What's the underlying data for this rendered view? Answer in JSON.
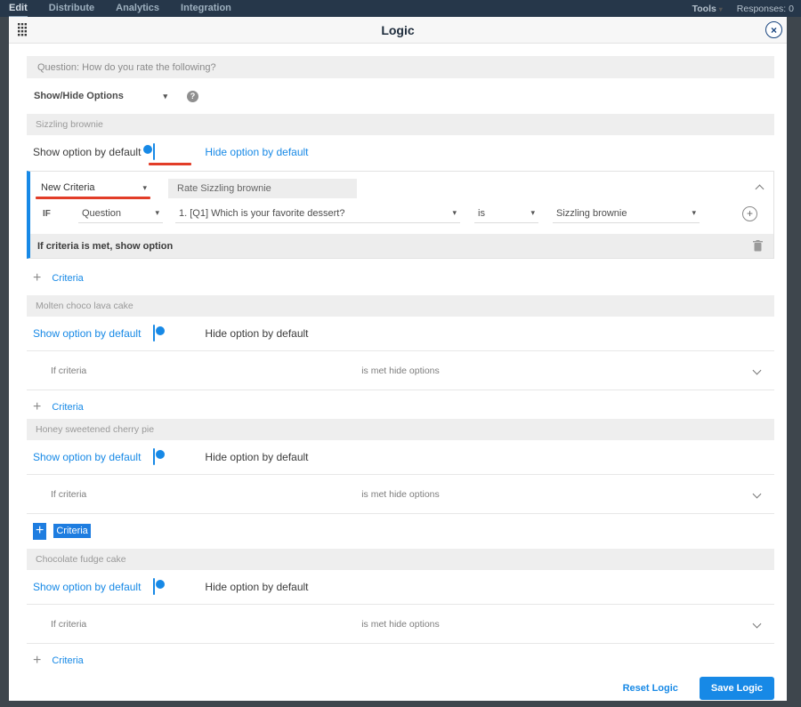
{
  "colors": {
    "accent": "#1789e6",
    "annotation_red": "#e23d28",
    "topnav_bg": "#26374a",
    "selection_blue": "#1e7de0"
  },
  "icons": {
    "caret": "▾",
    "help": "?",
    "close": "×",
    "plus": "+"
  },
  "topnav": {
    "items": [
      "Edit",
      "Distribute",
      "Analytics",
      "Integration"
    ],
    "tools": "Tools",
    "responses": "Responses: 0"
  },
  "modal": {
    "title": "Logic"
  },
  "question_bar": "Question: How do you rate the following?",
  "logic_type": {
    "value": "Show/Hide Options"
  },
  "toggle_labels": {
    "show": "Show option by default",
    "hide": "Hide option by default"
  },
  "add_criteria_label": "Criteria",
  "sections": [
    {
      "title": "Sizzling brownie",
      "card": {
        "criteria_name": "New Criteria",
        "option_ref": "Rate Sizzling brownie",
        "if": "IF",
        "subject": "Question",
        "question": "1. [Q1] Which is your favorite dessert?",
        "operator": "is",
        "value": "Sizzling brownie",
        "result": "If criteria is met, show option"
      }
    },
    {
      "title": "Molten choco lava cake",
      "collapsed_left": "If criteria",
      "collapsed_right": "is met hide options"
    },
    {
      "title": "Honey sweetened cherry pie",
      "collapsed_left": "If criteria",
      "collapsed_right": "is met hide options"
    },
    {
      "title": "Chocolate fudge cake",
      "collapsed_left": "If criteria",
      "collapsed_right": "is met hide options"
    }
  ],
  "footer": {
    "reset": "Reset Logic",
    "save": "Save Logic"
  }
}
